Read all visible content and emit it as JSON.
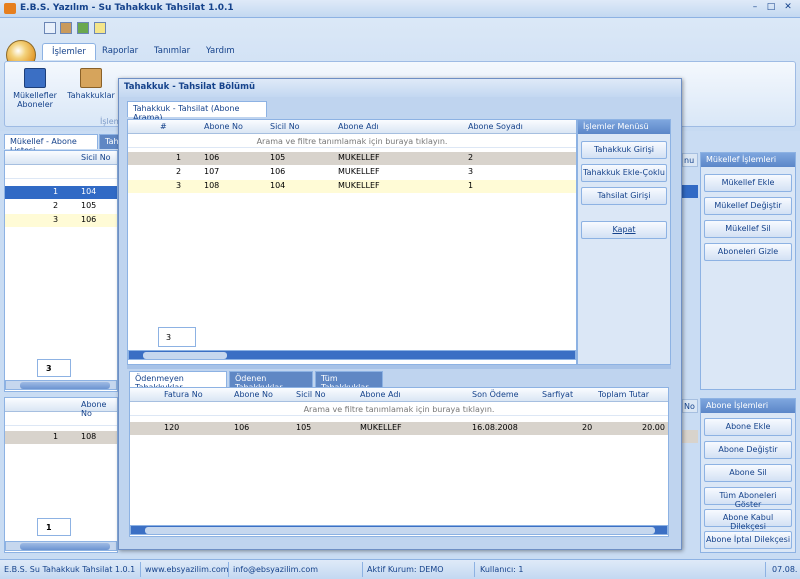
{
  "app": {
    "title": "E.B.S. Yazılım - Su Tahakkuk Tahsilat 1.0.1"
  },
  "ribbon": {
    "tabs": [
      "İşlemler",
      "Raporlar",
      "Tanımlar",
      "Yardım"
    ],
    "buttons": {
      "mukellefler": "Mükellefler\nAboneler",
      "tahakkuklar": "Tahakkuklar"
    },
    "group_label": "İşlem"
  },
  "left_top": {
    "tabs": [
      "Mükellef - Abone Listesi",
      "Tah"
    ],
    "col": "Sicil No",
    "rows": [
      {
        "n": "1",
        "v": "104"
      },
      {
        "n": "2",
        "v": "105"
      },
      {
        "n": "3",
        "v": "106"
      }
    ],
    "count": "3"
  },
  "left_bottom": {
    "col": "Abone No",
    "rows": [
      {
        "n": "1",
        "v": "108"
      }
    ],
    "count": "1"
  },
  "right_side": {
    "partial_header_top": "nu",
    "partial_header_bottom": "No",
    "mukellef_group": "Mükellef İşlemleri",
    "mukellef_buttons": [
      "Mükellef Ekle",
      "Mükellef Değiştir",
      "Mükellef Sil",
      "Aboneleri Gizle"
    ],
    "abone_group": "Abone İşlemleri",
    "abone_buttons": [
      "Abone Ekle",
      "Abone Değiştir",
      "Abone Sil",
      "Tüm Aboneleri Göster",
      "Abone Kabul Dilekçesi",
      "Abone İptal Dilekçesi"
    ]
  },
  "dialog": {
    "title": "Tahakkuk - Tahsilat Bölümü",
    "tab": "Tahakkuk - Tahsilat (Abone Arama)",
    "grid_columns": [
      "#",
      "Abone No",
      "Sicil No",
      "Abone Adı",
      "Abone Soyadı"
    ],
    "filter_hint": "Arama ve filtre tanımlamak için buraya tıklayın.",
    "rows": [
      {
        "n": "1",
        "abone": "106",
        "sicil": "105",
        "ad": "MUKELLEF",
        "soyad": "2"
      },
      {
        "n": "2",
        "abone": "107",
        "sicil": "106",
        "ad": "MUKELLEF",
        "soyad": "3"
      },
      {
        "n": "3",
        "abone": "108",
        "sicil": "104",
        "ad": "MUKELLEF",
        "soyad": "1"
      }
    ],
    "count": "3",
    "menu_title": "İşlemler Menüsü",
    "menu_buttons": [
      "Tahakkuk Girişi",
      "Tahakkuk Ekle-Çoklu",
      "Tahsilat Girişi",
      "Kapat"
    ],
    "lower_tabs": [
      "Ödenmeyen Tahakkuklar",
      "Ödenen Tahakkuklar",
      "Tüm Tahakkuklar"
    ],
    "lower_columns": [
      "Fatura No",
      "Abone No",
      "Sicil No",
      "Abone Adı",
      "Son Ödeme",
      "Sarfiyat",
      "Toplam Tutar"
    ],
    "lower_filter_hint": "Arama ve filtre tanımlamak için buraya tıklayın.",
    "lower_rows": [
      {
        "fatura": "120",
        "abone": "106",
        "sicil": "105",
        "ad": "MUKELLEF",
        "son": "16.08.2008",
        "sarf": "20",
        "tutar": "20.00"
      }
    ]
  },
  "status": {
    "app": "E.B.S. Su Tahakkuk Tahsilat 1.0.1",
    "web": "www.ebsyazilim.com",
    "mail": "info@ebsyazilim.com",
    "kurum": "Aktif Kurum: DEMO",
    "kullanici": "Kullanıcı: 1",
    "date": "07.08."
  }
}
